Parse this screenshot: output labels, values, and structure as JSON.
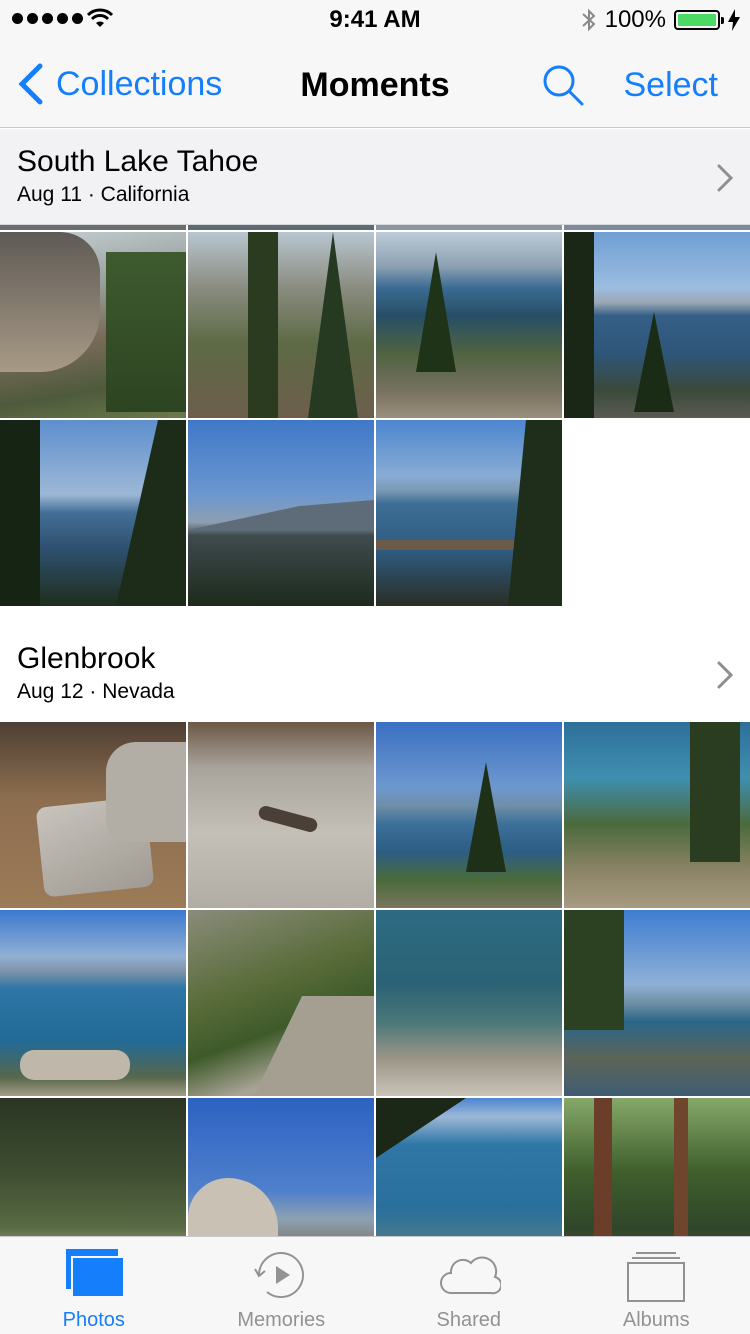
{
  "status_bar": {
    "time": "9:41 AM",
    "battery_text": "100%",
    "icons": [
      "signal-dots-icon",
      "wifi-icon",
      "bluetooth-icon",
      "battery-icon",
      "charging-icon"
    ]
  },
  "nav": {
    "back_label": "Collections",
    "title": "Moments",
    "select_label": "Select",
    "icons": [
      "chevron-left-icon",
      "search-icon"
    ]
  },
  "colors": {
    "accent": "#147efb",
    "inactive_tab": "#929292",
    "battery_green": "#4cd964"
  },
  "sections": [
    {
      "title": "South Lake Tahoe",
      "subtitle": "Aug 11 · California",
      "photo_count_visible": 7,
      "photos": [
        "rocky cliff trail",
        "trail with pines and railing",
        "lake cove with pines",
        "lake view with pine tree",
        "lake through pines",
        "mountain lake at dusk",
        "lake overlook with railing"
      ]
    },
    {
      "title": "Glenbrook",
      "subtitle": "Aug 12 · Nevada",
      "photo_count_visible": 12,
      "photos": [
        "granite boulder",
        "lizard on granite",
        "lake framed by pines",
        "lake shore trail",
        "lake with buoy",
        "shrubs on rocks",
        "clear water over rocks",
        "rocky shoreline",
        "forest shoreline rocks",
        "boulder and sky",
        "lake with pine branches",
        "forest with fallen log"
      ]
    }
  ],
  "tabs": [
    {
      "label": "Photos",
      "icon": "photos-icon",
      "active": true
    },
    {
      "label": "Memories",
      "icon": "memories-icon",
      "active": false
    },
    {
      "label": "Shared",
      "icon": "cloud-icon",
      "active": false
    },
    {
      "label": "Albums",
      "icon": "albums-icon",
      "active": false
    }
  ]
}
